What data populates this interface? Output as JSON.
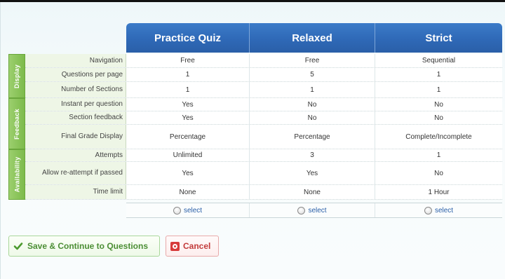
{
  "columns": [
    "Practice Quiz",
    "Relaxed",
    "Strict"
  ],
  "groups": [
    "Display",
    "Feedback",
    "Availability"
  ],
  "rows": [
    {
      "label": "Navigation",
      "values": [
        "Free",
        "Free",
        "Sequential"
      ]
    },
    {
      "label": "Questions per page",
      "values": [
        "1",
        "5",
        "1"
      ]
    },
    {
      "label": "Number of Sections",
      "values": [
        "1",
        "1",
        "1"
      ]
    },
    {
      "label": "Instant per question",
      "values": [
        "Yes",
        "No",
        "No"
      ]
    },
    {
      "label": "Section feedback",
      "values": [
        "Yes",
        "No",
        "No"
      ]
    },
    {
      "label": "Final Grade Display",
      "values": [
        "Percentage",
        "Percentage",
        "Complete/Incomplete"
      ]
    },
    {
      "label": "Attempts",
      "values": [
        "Unlimited",
        "3",
        "1"
      ]
    },
    {
      "label": "Allow re-attempt if passed",
      "values": [
        "Yes",
        "Yes",
        "No"
      ]
    },
    {
      "label": "Time limit",
      "values": [
        "None",
        "None",
        "1 Hour"
      ]
    }
  ],
  "select_label": "select",
  "buttons": {
    "save": "Save & Continue to Questions",
    "cancel": "Cancel"
  },
  "colors": {
    "header_blue": "#2f69b7",
    "group_green": "#7dbb4b",
    "save_green": "#4b8e34",
    "cancel_red": "#c23a3a"
  }
}
